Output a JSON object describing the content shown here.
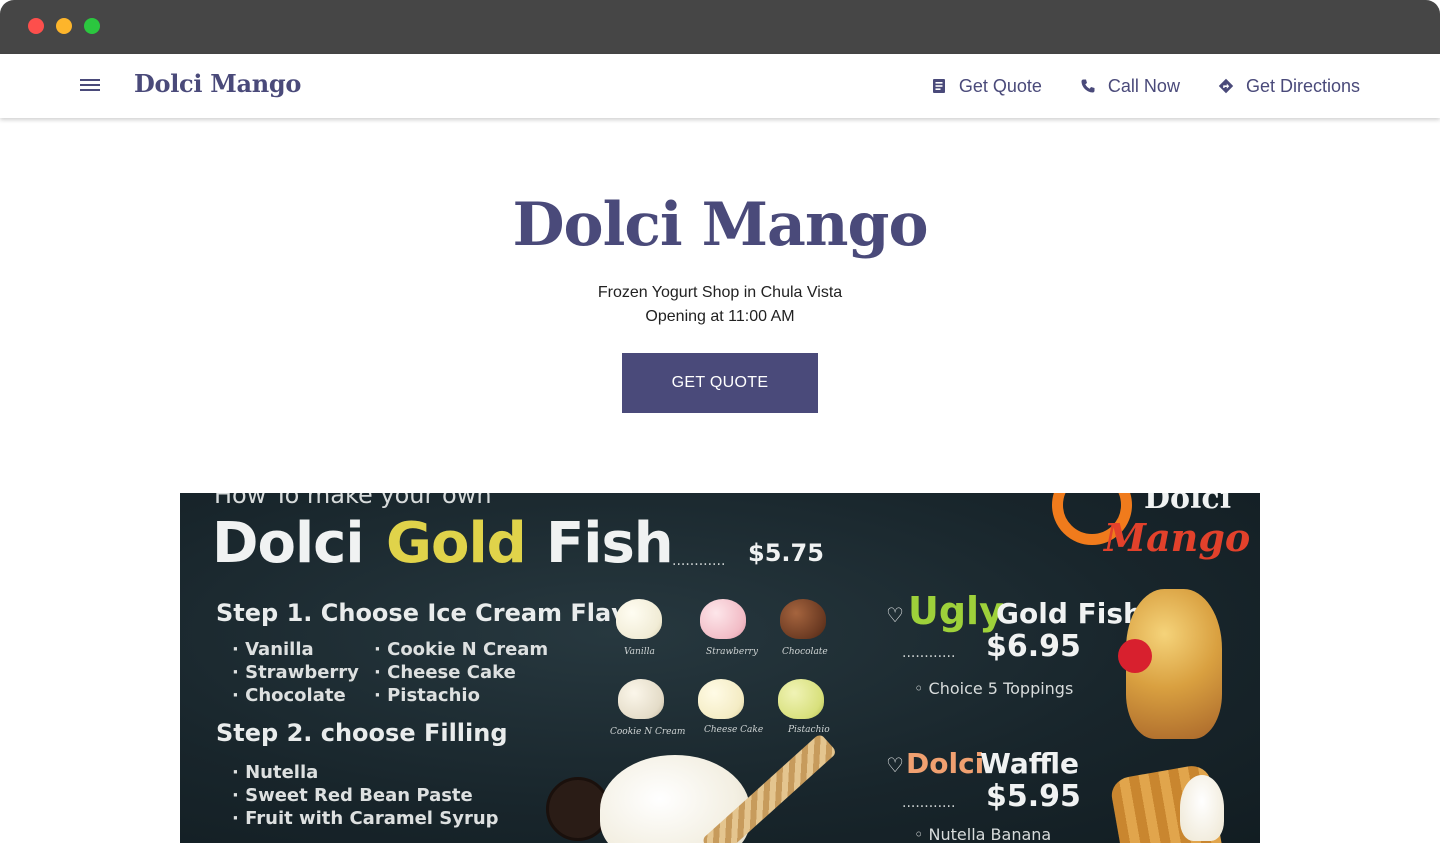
{
  "navbar": {
    "brand": "Dolci Mango",
    "actions": [
      {
        "label": "Get Quote",
        "icon": "document-icon"
      },
      {
        "label": "Call Now",
        "icon": "phone-icon"
      },
      {
        "label": "Get Directions",
        "icon": "directions-icon"
      }
    ]
  },
  "hero": {
    "title": "Dolci Mango",
    "subtitle": "Frozen Yogurt Shop in Chula Vista",
    "hours": "Opening at 11:00 AM",
    "cta_label": "GET QUOTE"
  },
  "banner": {
    "howto": "How To make your own",
    "title_part1": "Dolci",
    "title_part2": "Gold",
    "title_part3": "Fish",
    "dots": "............",
    "price_goldfish": "$5.75",
    "step1": "Step 1. Choose Ice Cream Flavor",
    "flavors_col1": [
      "· Vanilla",
      "· Strawberry",
      "· Chocolate"
    ],
    "flavors_col2": [
      "· Cookie N Cream",
      "· Cheese Cake",
      "· Pistachio"
    ],
    "scoop_labels": [
      "Vanilla",
      "Strawberry",
      "Chocolate",
      "Cookie N Cream",
      "Cheese Cake",
      "Pistachio"
    ],
    "step2": "Step 2. choose Filling",
    "fillings": [
      "· Nutella",
      "· Sweet Red Bean Paste",
      "· Fruit with Caramel Syrup"
    ],
    "ugly_word": "Ugly",
    "ugly_rest": "Gold Fish",
    "price_ugly": "$6.95",
    "ugly_note": "◦ Choice 5 Toppings",
    "waffle_word": "Dolci",
    "waffle_rest": "Waffle",
    "price_waffle": "$5.95",
    "waffle_note": "◦ Nutella Banana",
    "heart": "♡",
    "logo_top": "Dolci",
    "logo_bottom": "Mango"
  },
  "colors": {
    "brand": "#4a4a7a",
    "chalkboard": "#18252b",
    "logo_orange": "#f07b1c",
    "logo_red": "#e2412b"
  }
}
